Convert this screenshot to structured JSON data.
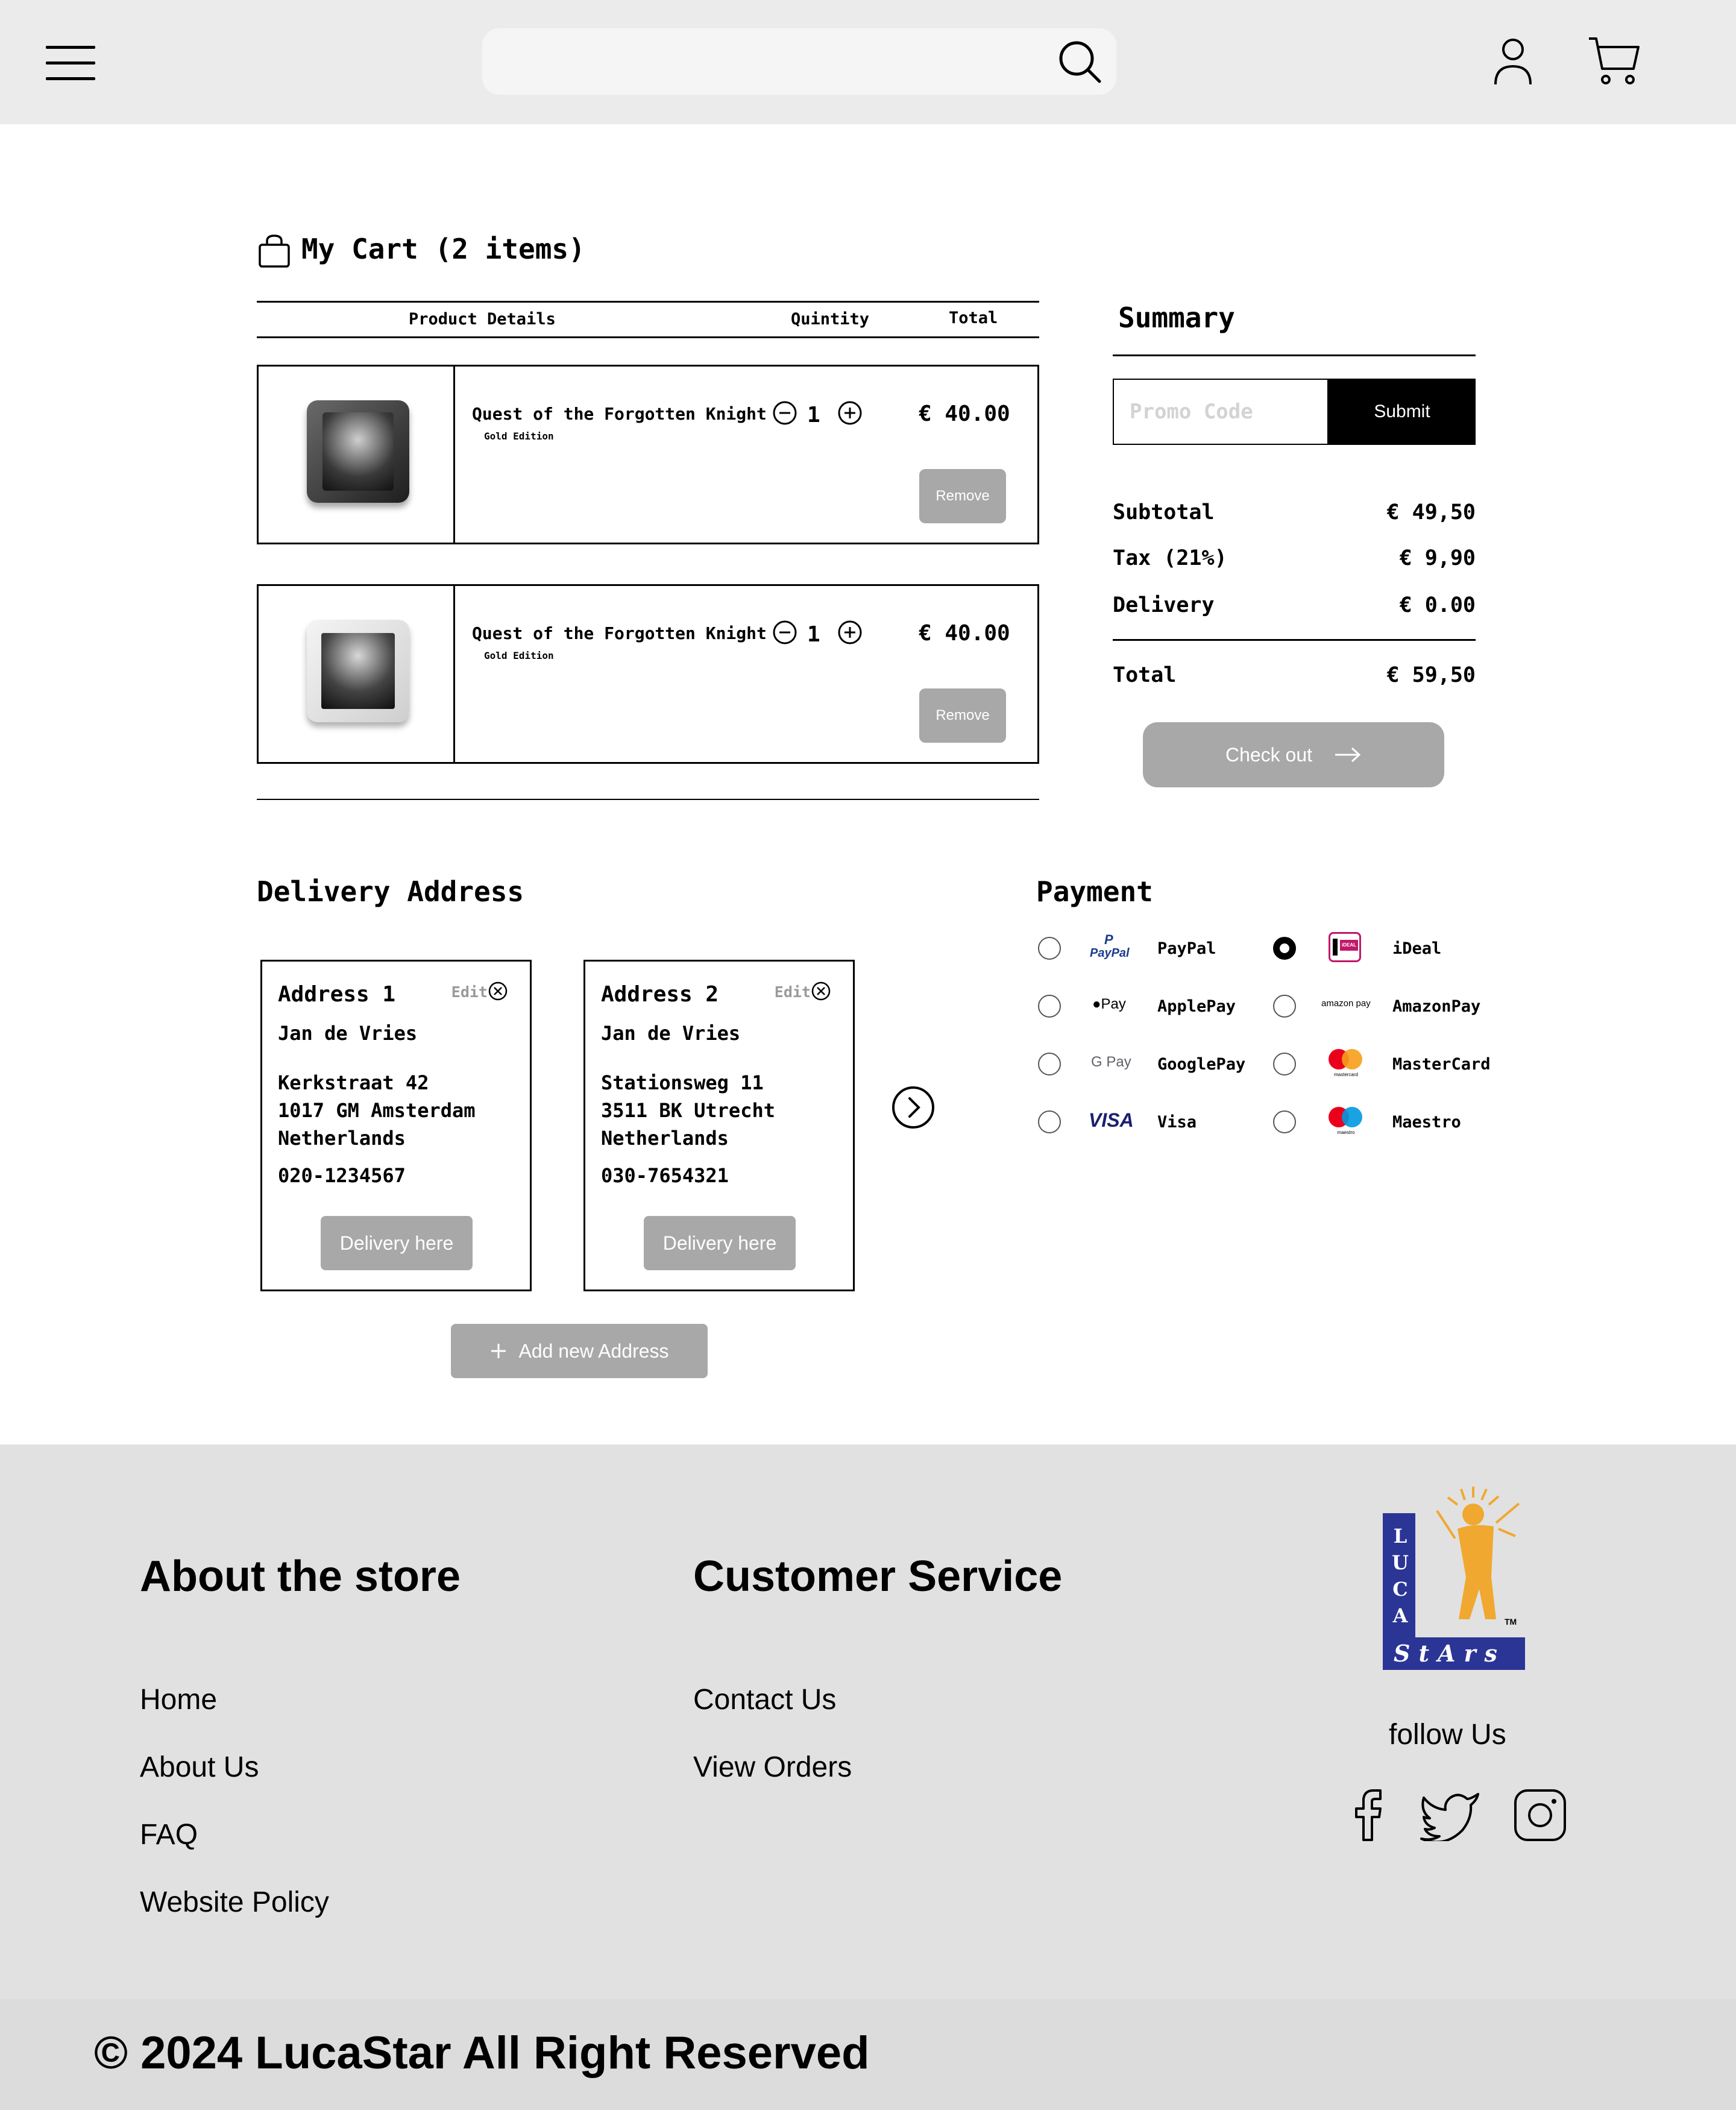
{
  "header": {
    "search": {
      "placeholder": "",
      "value": ""
    },
    "icons": [
      "menu-icon",
      "search-icon",
      "user-icon",
      "cart-icon"
    ]
  },
  "cart": {
    "title": "My Cart (2 items)",
    "columns": {
      "product": "Product Details",
      "quantity": "Quintity",
      "total": "Total"
    },
    "items": [
      {
        "name": "Quest of the Forgotten Knight",
        "edition": "Gold Edition",
        "quantity": "1",
        "total": "€ 40.00",
        "remove_label": "Remove"
      },
      {
        "name": "Quest of the Forgotten Knight",
        "edition": "Gold Edition",
        "quantity": "1",
        "total": "€ 40.00",
        "remove_label": "Remove"
      }
    ]
  },
  "summary": {
    "title": "Summary",
    "promo_placeholder": "Promo Code",
    "submit_label": "Submit",
    "subtotal_label": "Subtotal",
    "subtotal_value": "€ 49,50",
    "tax_label": "Tax (21%)",
    "tax_value": "€ 9,90",
    "delivery_label": "Delivery",
    "delivery_value": "€ 0.00",
    "total_label": "Total",
    "total_value": "€ 59,50",
    "checkout_label": "Check out"
  },
  "delivery": {
    "title": "Delivery Address",
    "edit_label": "Edit",
    "button_label": "Delivery here",
    "add_label": "Add new Address",
    "addresses": [
      {
        "title": "Address 1",
        "name": "Jan de Vries",
        "street": "Kerkstraat 42",
        "city": "1017 GM Amsterdam",
        "country": "Netherlands",
        "phone": "020-1234567"
      },
      {
        "title": "Address 2",
        "name": "Jan de Vries",
        "street": "Stationsweg 11",
        "city": "3511 BK Utrecht",
        "country": "Netherlands",
        "phone": "030-7654321"
      }
    ]
  },
  "payment": {
    "title": "Payment",
    "selected": "iDeal",
    "methods": [
      {
        "label": "PayPal",
        "logo": "PayPal"
      },
      {
        "label": "iDeal",
        "logo": "iDEAL"
      },
      {
        "label": "ApplePay",
        "logo": "Pay"
      },
      {
        "label": "AmazonPay",
        "logo": "amazon pay"
      },
      {
        "label": "GooglePay",
        "logo": "G Pay"
      },
      {
        "label": "MasterCard",
        "logo": "mastercard"
      },
      {
        "label": "Visa",
        "logo": "VISA"
      },
      {
        "label": "Maestro",
        "logo": "maestro"
      }
    ]
  },
  "footer": {
    "about_heading": "About the store",
    "about_links": [
      "Home",
      "About Us",
      "FAQ",
      "Website Policy"
    ],
    "service_heading": "Customer Service",
    "service_links": [
      "Contact Us",
      "View Orders"
    ],
    "logo_letters": {
      "vertical": "LUCA",
      "bottom": "StArs",
      "tm": "TM"
    },
    "follow_label": "follow Us",
    "social_icons": [
      "facebook-icon",
      "twitter-icon",
      "instagram-icon"
    ],
    "copyright": "© 2024 LucaStar All Right Reserved"
  },
  "colors": {
    "header_bg": "#ebebeb",
    "button_gray": "#a8a8a8",
    "footer_bg": "#e1e1e1",
    "logo_blue": "#2b3596",
    "logo_yellow": "#f0a830"
  }
}
